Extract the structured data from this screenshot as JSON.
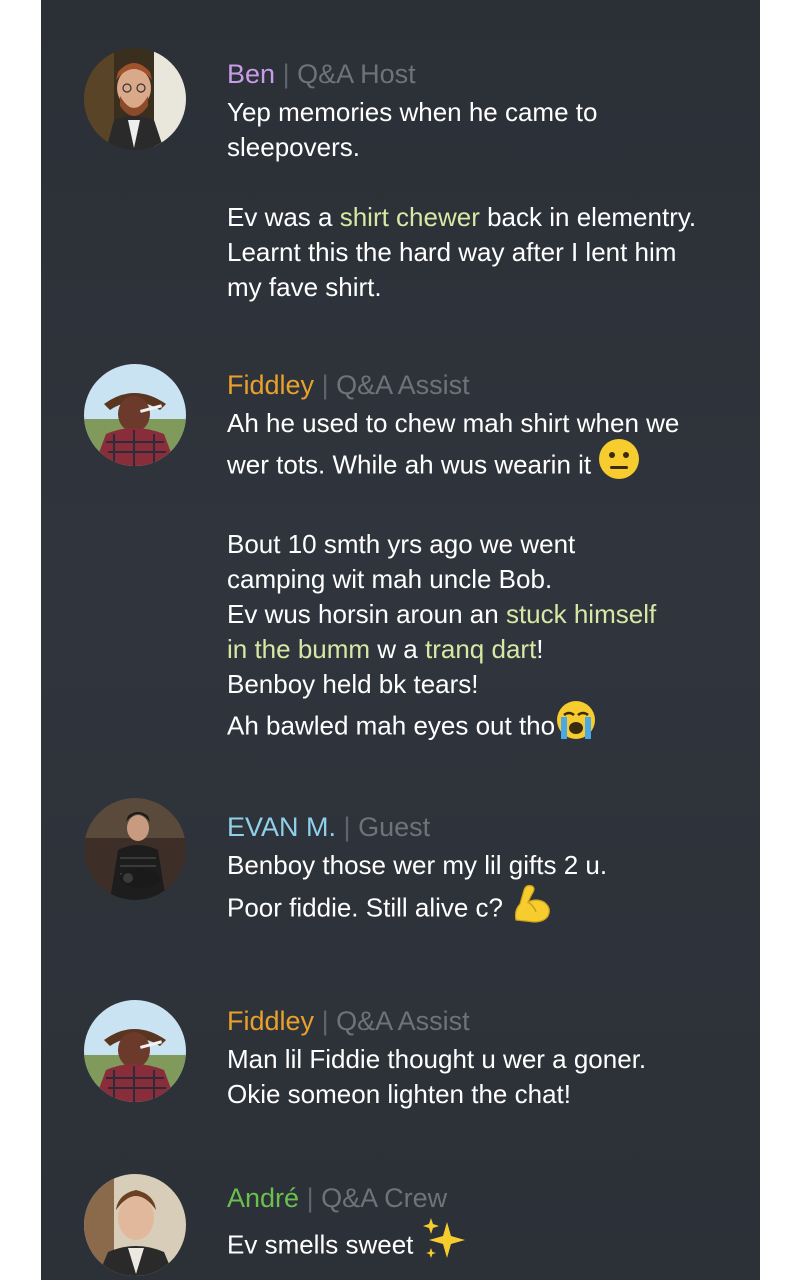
{
  "colors": {
    "ben": "#c89ce8",
    "fiddley": "#e8a12c",
    "evan": "#8fd0ea",
    "andre": "#6bbf4e",
    "highlight": "#d6e9a4"
  },
  "messages": [
    {
      "name": "Ben",
      "role": "Q&A Host",
      "lines": [
        "Yep memories when he came to",
        "sleepovers.",
        "",
        {
          "pre": "Ev was a ",
          "hl": "shirt chewer",
          "post": " back in elementry."
        },
        "Learnt this the hard way after I lent him",
        "my fave shirt."
      ]
    },
    {
      "name": "Fiddley",
      "role": "Q&A Assist",
      "lines": [
        "Ah he used to chew mah shirt when we",
        {
          "text": "wer tots. While ah wus wearin it ",
          "emoji": "neutral-face-icon"
        },
        "",
        "Bout 10 smth yrs ago we went",
        "camping wit mah uncle Bob.",
        {
          "pre": "Ev wus horsin aroun an ",
          "hl": "stuck himself",
          "post": ""
        },
        {
          "pre": "",
          "hl": "in the bumm",
          "mid": " w a ",
          "hl2": "tranq dart",
          "post": "!"
        },
        "Benboy held bk tears!",
        {
          "text": "Ah bawled mah eyes out tho",
          "emoji": "crying-face-icon"
        }
      ]
    },
    {
      "name": "EVAN M.",
      "role": "Guest",
      "lines": [
        "Benboy those wer my lil gifts 2 u.",
        {
          "text": "Poor fiddie. Still alive c? ",
          "emoji": "flexed-biceps-icon"
        }
      ]
    },
    {
      "name": "Fiddley",
      "role": "Q&A Assist",
      "lines": [
        "Man lil Fiddie thought u wer a goner.",
        "Okie someon lighten the chat!"
      ]
    },
    {
      "name": "André",
      "role": "Q&A Crew",
      "lines": [
        {
          "text": "Ev smells sweet ",
          "emoji": "sparkles-icon"
        }
      ]
    }
  ],
  "separator": "|"
}
